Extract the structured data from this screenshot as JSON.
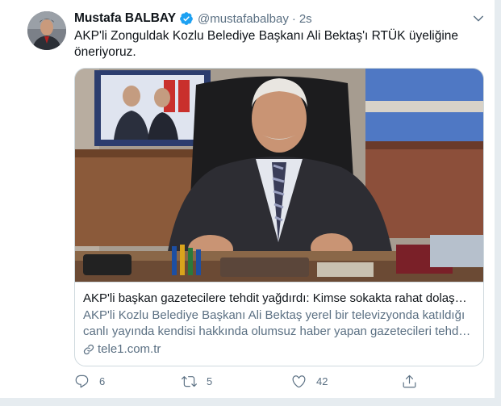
{
  "tweet": {
    "display_name": "Mustafa BALBAY",
    "handle": "@mustafabalbay",
    "separator": "·",
    "time": "2s",
    "text_line1": "AKP'li Zonguldak Kozlu Belediye Başkanı Ali Bektaş'ı RTÜK üyeliğine",
    "text_line2": "öneriyoruz."
  },
  "card": {
    "title": "AKP'li başkan gazetecilere tehdit yağdırdı: Kimse sokakta rahat dolaş…",
    "description_line1": "AKP'li Kozlu Belediye Başkanı Ali Bektaş yerel bir televizyonda katıldığı",
    "description_line2": "canlı yayında kendisi hakkında olumsuz haber yapan gazetecileri tehd…",
    "domain": "tele1.com.tr"
  },
  "actions": {
    "reply_count": "6",
    "retweet_count": "5",
    "like_count": "42"
  },
  "colors": {
    "accent": "#1da1f2",
    "secondary_text": "#5b7083",
    "border": "#cfd9de"
  },
  "icons": [
    "verified-badge-icon",
    "chevron-down-icon",
    "link-icon",
    "reply-icon",
    "retweet-icon",
    "like-icon",
    "share-icon"
  ]
}
